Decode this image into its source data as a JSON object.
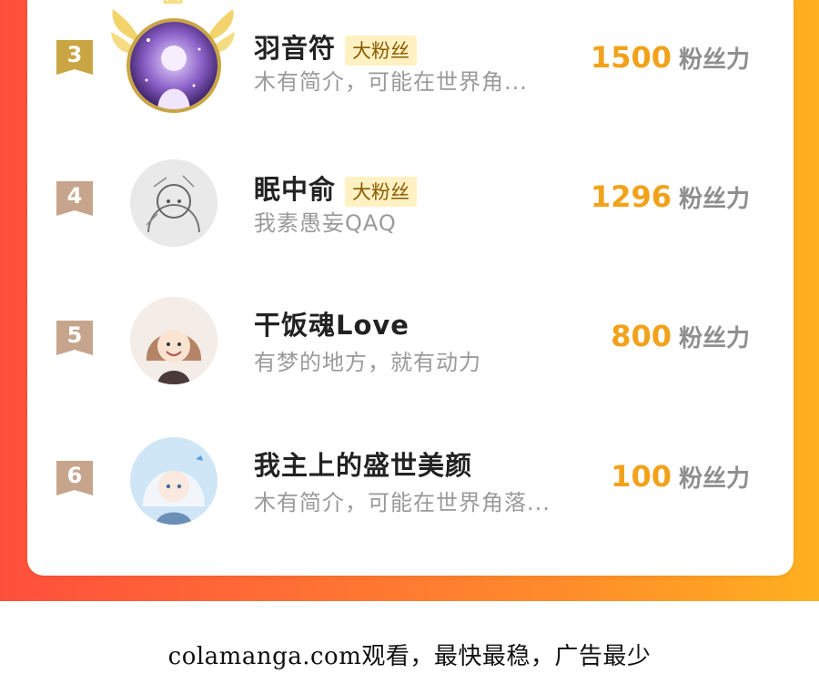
{
  "colors": {
    "accent_orange": "#f2a21a",
    "tag_bg": "#fff1c2",
    "gold_badge": "#c9a544",
    "tan_badge": "#c7a58c",
    "gradient_left": "#ff4f3c",
    "gradient_right": "#ffb020"
  },
  "ranking": [
    {
      "rank": "3",
      "name": "羽音符",
      "tag": "大粉丝",
      "bio": "木有简介，可能在世界角...",
      "power": "1500",
      "power_unit": "粉丝力",
      "badge_style": "gold",
      "avatar_icon": "anime-girl-purple-avatar"
    },
    {
      "rank": "4",
      "name": "眠中俞",
      "tag": "大粉丝",
      "bio": "我素愚妄QAQ",
      "power": "1296",
      "power_unit": "粉丝力",
      "badge_style": "tan",
      "avatar_icon": "sketch-avatar"
    },
    {
      "rank": "5",
      "name": "干饭魂Love",
      "tag": "",
      "bio": "有梦的地方，就有动力",
      "power": "800",
      "power_unit": "粉丝力",
      "badge_style": "tan",
      "avatar_icon": "anime-girl-brown-hair-avatar"
    },
    {
      "rank": "6",
      "name": "我主上的盛世美颜",
      "tag": "",
      "bio": "木有简介，可能在世界角落...",
      "power": "100",
      "power_unit": "粉丝力",
      "badge_style": "tan",
      "avatar_icon": "anime-boy-white-hair-avatar"
    }
  ],
  "footer_text": "colamanga.com观看，最快最稳，广告最少"
}
